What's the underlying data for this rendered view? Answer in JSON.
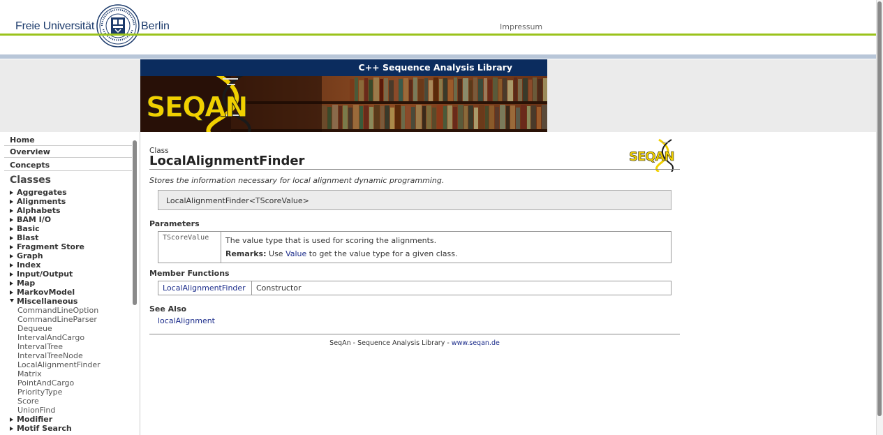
{
  "header": {
    "university_left": "Freie Universität",
    "university_right": "Berlin",
    "impressum": "Impressum",
    "brand_green": "#9ac31c",
    "brand_blue": "#1b3a6b"
  },
  "banner": {
    "title": "C++ Sequence Analysis Library",
    "logo_text": "SEQAN"
  },
  "sidebar": {
    "top_nav": [
      "Home",
      "Overview",
      "Concepts"
    ],
    "classes_heading": "Classes",
    "items": [
      {
        "label": "Aggregates",
        "type": "group",
        "state": "collapsed"
      },
      {
        "label": "Alignments",
        "type": "group",
        "state": "collapsed"
      },
      {
        "label": "Alphabets",
        "type": "group",
        "state": "collapsed"
      },
      {
        "label": "BAM I/O",
        "type": "group",
        "state": "collapsed"
      },
      {
        "label": "Basic",
        "type": "group",
        "state": "collapsed"
      },
      {
        "label": "Blast",
        "type": "group",
        "state": "collapsed"
      },
      {
        "label": "Fragment Store",
        "type": "group",
        "state": "collapsed"
      },
      {
        "label": "Graph",
        "type": "group",
        "state": "collapsed"
      },
      {
        "label": "Index",
        "type": "group",
        "state": "collapsed"
      },
      {
        "label": "Input/Output",
        "type": "group",
        "state": "collapsed"
      },
      {
        "label": "Map",
        "type": "group",
        "state": "collapsed"
      },
      {
        "label": "MarkovModel",
        "type": "group",
        "state": "collapsed"
      },
      {
        "label": "Miscellaneous",
        "type": "group",
        "state": "expanded"
      },
      {
        "label": "CommandLineOption",
        "type": "sub"
      },
      {
        "label": "CommandLineParser",
        "type": "sub"
      },
      {
        "label": "Dequeue",
        "type": "sub"
      },
      {
        "label": "IntervalAndCargo",
        "type": "sub"
      },
      {
        "label": "IntervalTree",
        "type": "sub"
      },
      {
        "label": "IntervalTreeNode",
        "type": "sub"
      },
      {
        "label": "LocalAlignmentFinder",
        "type": "sub"
      },
      {
        "label": "Matrix",
        "type": "sub"
      },
      {
        "label": "PointAndCargo",
        "type": "sub"
      },
      {
        "label": "PriorityType",
        "type": "sub"
      },
      {
        "label": "Score",
        "type": "sub"
      },
      {
        "label": "UnionFind",
        "type": "sub"
      },
      {
        "label": "Modifier",
        "type": "group",
        "state": "collapsed"
      },
      {
        "label": "Motif Search",
        "type": "group",
        "state": "collapsed"
      }
    ]
  },
  "doc": {
    "kind": "Class",
    "title": "LocalAlignmentFinder",
    "logo_text": "SEQAN",
    "description": "Stores the information necessary for local alignment dynamic programming.",
    "signature": "LocalAlignmentFinder<TScoreValue>",
    "parameters_heading": "Parameters",
    "parameters": [
      {
        "name": "TScoreValue",
        "description": "The value type that is used for scoring the alignments.",
        "remarks_label": "Remarks:",
        "remarks_pre": "Use",
        "remarks_link": "Value",
        "remarks_post": "to get the value type for a given class."
      }
    ],
    "member_functions_heading": "Member Functions",
    "member_functions": [
      {
        "name": "LocalAlignmentFinder",
        "description": "Constructor"
      }
    ],
    "see_also_heading": "See Also",
    "see_also": [
      "localAlignment"
    ],
    "footer_text": "SeqAn - Sequence Analysis Library - ",
    "footer_link": "www.seqan.de",
    "link_color": "#1a2b8a"
  }
}
